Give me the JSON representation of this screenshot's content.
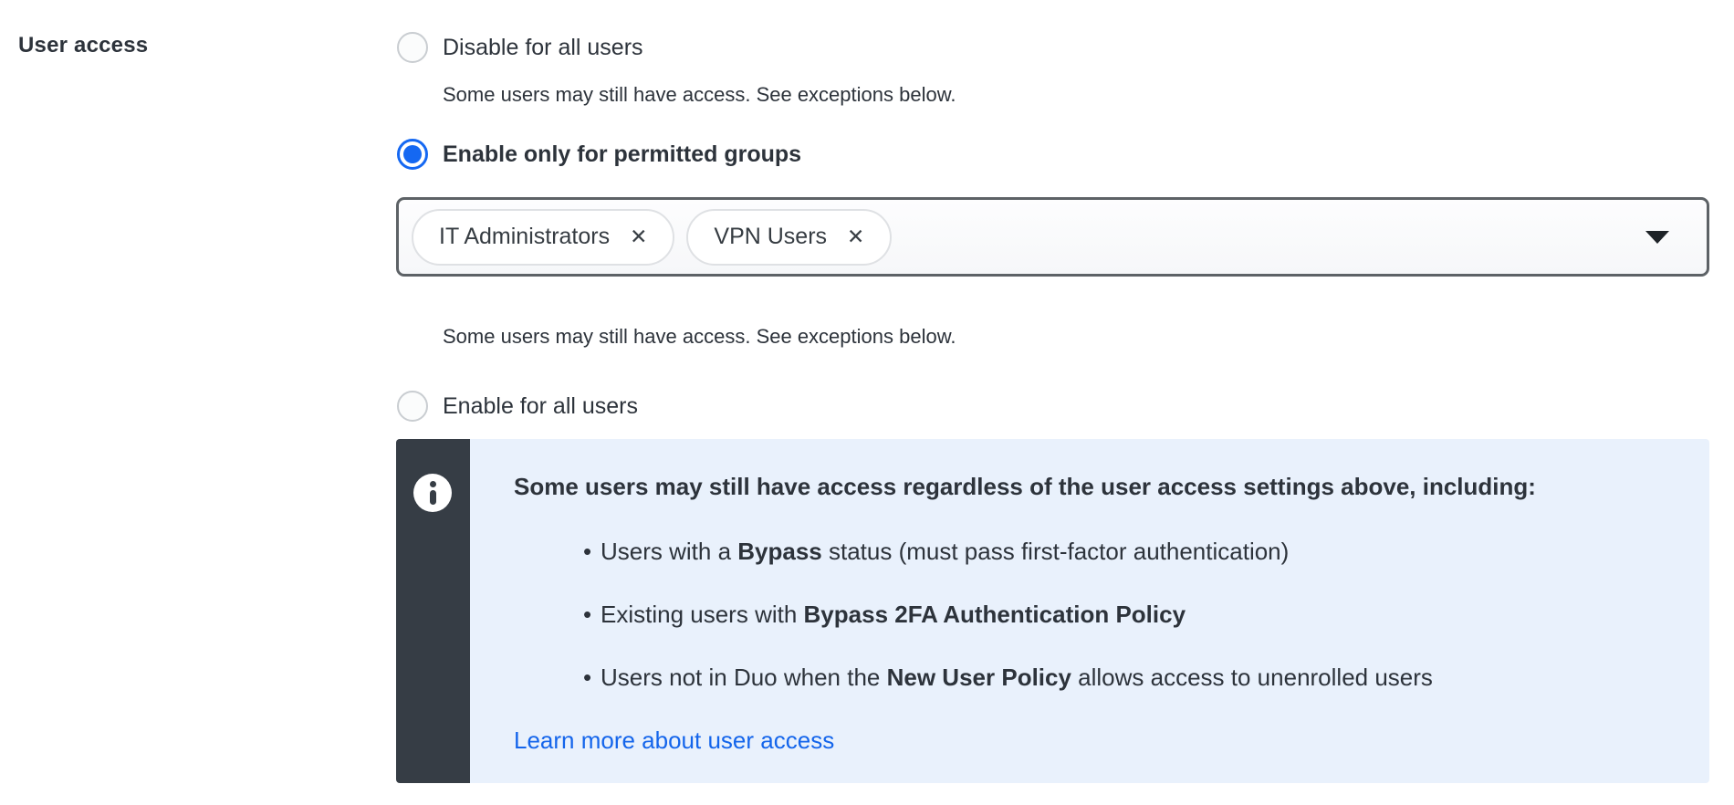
{
  "form": {
    "label": "User access",
    "options": [
      {
        "id": "disable-all",
        "label": "Disable for all users",
        "selected": false,
        "helper": "Some users may still have access. See exceptions below."
      },
      {
        "id": "permitted-groups",
        "label": "Enable only for permitted groups",
        "selected": true,
        "helper": "Some users may still have access. See exceptions below."
      },
      {
        "id": "enable-all",
        "label": "Enable for all users",
        "selected": false
      }
    ],
    "group_select": {
      "tags": [
        {
          "label": "IT Administrators",
          "remove_icon": "✕"
        },
        {
          "label": "VPN Users",
          "remove_icon": "✕"
        }
      ],
      "caret_icon": "dropdown-caret"
    }
  },
  "info_box": {
    "icon": "info-icon",
    "heading": "Some users may still have access regardless of the user access settings above, including:",
    "bullets": [
      [
        {
          "text": "Users with a "
        },
        {
          "text": "Bypass",
          "bold": true
        },
        {
          "text": " status (must pass first-factor authentication)"
        }
      ],
      [
        {
          "text": "Existing users with "
        },
        {
          "text": "Bypass 2FA Authentication Policy",
          "bold": true
        }
      ],
      [
        {
          "text": "Users not in Duo when the "
        },
        {
          "text": "New User Policy",
          "bold": true
        },
        {
          "text": " allows access to unenrolled users"
        }
      ]
    ],
    "link": "Learn more about user access"
  },
  "colors": {
    "accent_blue": "#1568f2",
    "link_blue": "#1465eb",
    "info_background": "#e9f1fc",
    "info_sidebar": "#363d45",
    "text": "#2d333b",
    "select_border": "#5d6266",
    "tag_border": "#dfe1e4",
    "radio_border": "#c9cdd1"
  }
}
